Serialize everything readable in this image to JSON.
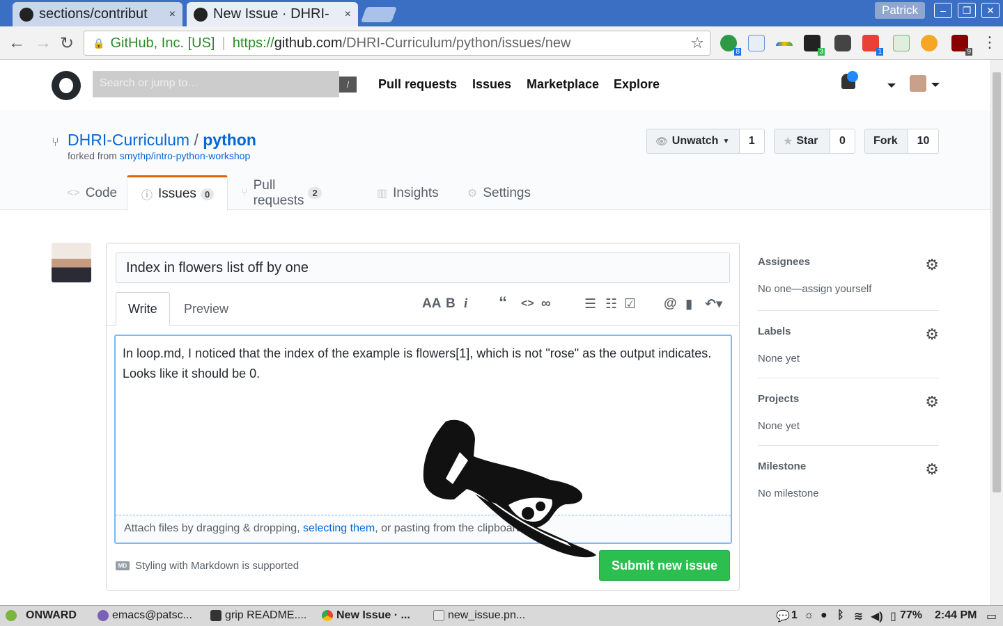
{
  "browser": {
    "tabs": [
      {
        "title": "sections/contribut",
        "close": "×"
      },
      {
        "title": "New Issue · DHRI-",
        "close": "×"
      }
    ],
    "profile": "Patrick",
    "window_controls": [
      "–",
      "❐",
      "✕"
    ],
    "address": {
      "org": "GitHub, Inc. [US]",
      "protocol": "https://",
      "domain": "github.com",
      "path": "/DHRI-Curriculum/python/issues/new"
    },
    "extension_badges": [
      "8",
      "3",
      "1",
      "9"
    ]
  },
  "github_header": {
    "search_placeholder": "Search or jump to…",
    "slash_key": "/",
    "nav": [
      "Pull requests",
      "Issues",
      "Marketplace",
      "Explore"
    ]
  },
  "repo": {
    "owner": "DHRI-Curriculum",
    "separator": "/",
    "name": "python",
    "forked_prefix": "forked from",
    "forked_from": "smythp/intro-python-workshop",
    "actions": {
      "unwatch": {
        "label": "Unwatch",
        "count": "1"
      },
      "star": {
        "label": "Star",
        "count": "0"
      },
      "fork": {
        "label": "Fork",
        "count": "10"
      }
    },
    "tabs": [
      {
        "label": "Code"
      },
      {
        "label": "Issues",
        "count": "0"
      },
      {
        "label": "Pull requests",
        "count": "2"
      },
      {
        "label": "Insights"
      },
      {
        "label": "Settings"
      }
    ]
  },
  "issue_form": {
    "title": "Index in flowers list off by one",
    "write_tab": "Write",
    "preview_tab": "Preview",
    "body_line1": "In loop.md, I noticed that the index of the example is flowers[1], which is not \"rose\" as the output indicates.",
    "body_line2": "Looks like it should be 0.",
    "attach_prefix": "Attach files by dragging & dropping, ",
    "attach_link": "selecting them",
    "attach_suffix": ", or pasting from the clipboard.",
    "markdown_badge": "MD",
    "markdown_note": "Styling with Markdown is supported",
    "submit": "Submit new issue"
  },
  "sidebar": [
    {
      "heading": "Assignees",
      "value": "No one—assign yourself"
    },
    {
      "heading": "Labels",
      "value": "None yet"
    },
    {
      "heading": "Projects",
      "value": "None yet"
    },
    {
      "heading": "Milestone",
      "value": "No milestone"
    }
  ],
  "taskbar": {
    "start": "ONWARD",
    "items": [
      "emacs@patsc...",
      "grip README....",
      "New Issue · ...",
      "new_issue.pn..."
    ],
    "notifications": "1",
    "battery": "77%",
    "time": "2:44 PM"
  }
}
